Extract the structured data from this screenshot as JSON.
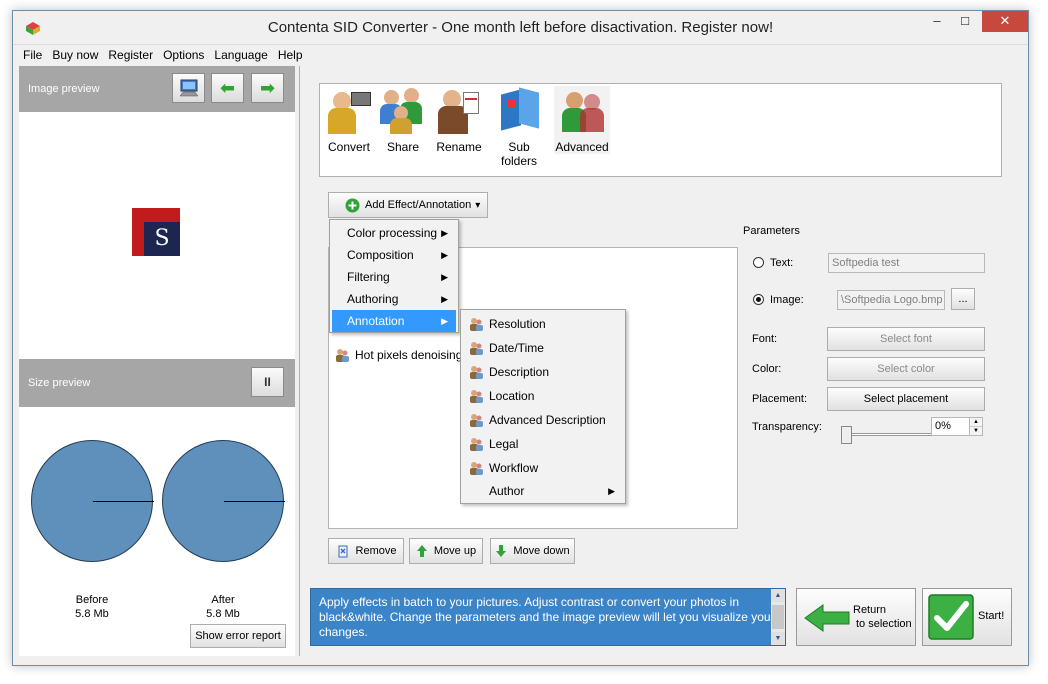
{
  "window": {
    "title": "Contenta SID Converter  - One month left before disactivation. Register now!",
    "close_glyph": "✕",
    "min_glyph": "–",
    "max_glyph": "☐"
  },
  "menu": [
    "File",
    "Buy now",
    "Register",
    "Options",
    "Language",
    "Help"
  ],
  "left": {
    "image_preview_label": "Image preview",
    "size_preview_label": "Size preview",
    "pause_glyph": "II",
    "prev_glyph": "⬅",
    "next_glyph": "➡",
    "logo_letter": "S",
    "before_label": "Before",
    "before_size": "5.8 Mb",
    "after_label": "After",
    "after_size": "5.8 Mb",
    "error_button": "Show error report"
  },
  "toolbar": [
    "Convert",
    "Share",
    "Rename",
    "Sub folders",
    "Advanced"
  ],
  "effects": {
    "add_button": "Add Effect/Annotation",
    "add_arrow": "▾",
    "list_item": "Hot pixels denoising",
    "remove_button": "Remove",
    "move_up_button": "Move up",
    "move_down_button": "Move down"
  },
  "dropdown": {
    "items": [
      "Color processing",
      "Composition",
      "Filtering",
      "Authoring",
      "Annotation"
    ],
    "active_index": 4,
    "submenu_glyph": "▶"
  },
  "submenu": {
    "items": [
      "Resolution",
      "Date/Time",
      "Description",
      "Location",
      "Advanced Description",
      "Legal",
      "Workflow",
      "Author"
    ]
  },
  "params": {
    "title": "Parameters",
    "text_label": "Text:",
    "text_value": "Softpedia test",
    "image_label": "Image:",
    "image_value": "\\Softpedia Logo.bmp",
    "browse_button": "...",
    "font_label": "Font:",
    "font_button": "Select font",
    "color_label": "Color:",
    "color_button": "Select color",
    "placement_label": "Placement:",
    "placement_button": "Select placement",
    "transparency_label": "Transparency:",
    "transparency_value": "0%",
    "transparency_level": 0,
    "spin_up": "▲",
    "spin_down": "▼"
  },
  "info": {
    "text": "Apply effects in batch to your pictures. Adjust contrast or convert your photos in black&white. Change the parameters and the image preview will let you visualize your changes."
  },
  "actions": {
    "return_line1": "Return",
    "return_line2": "to selection",
    "start_button": "Start!"
  },
  "colors": {
    "accent": "#3399ff",
    "info_bg": "#3c84c8",
    "pie": "#5f8fbb",
    "header_gray": "#a6a6a6"
  }
}
